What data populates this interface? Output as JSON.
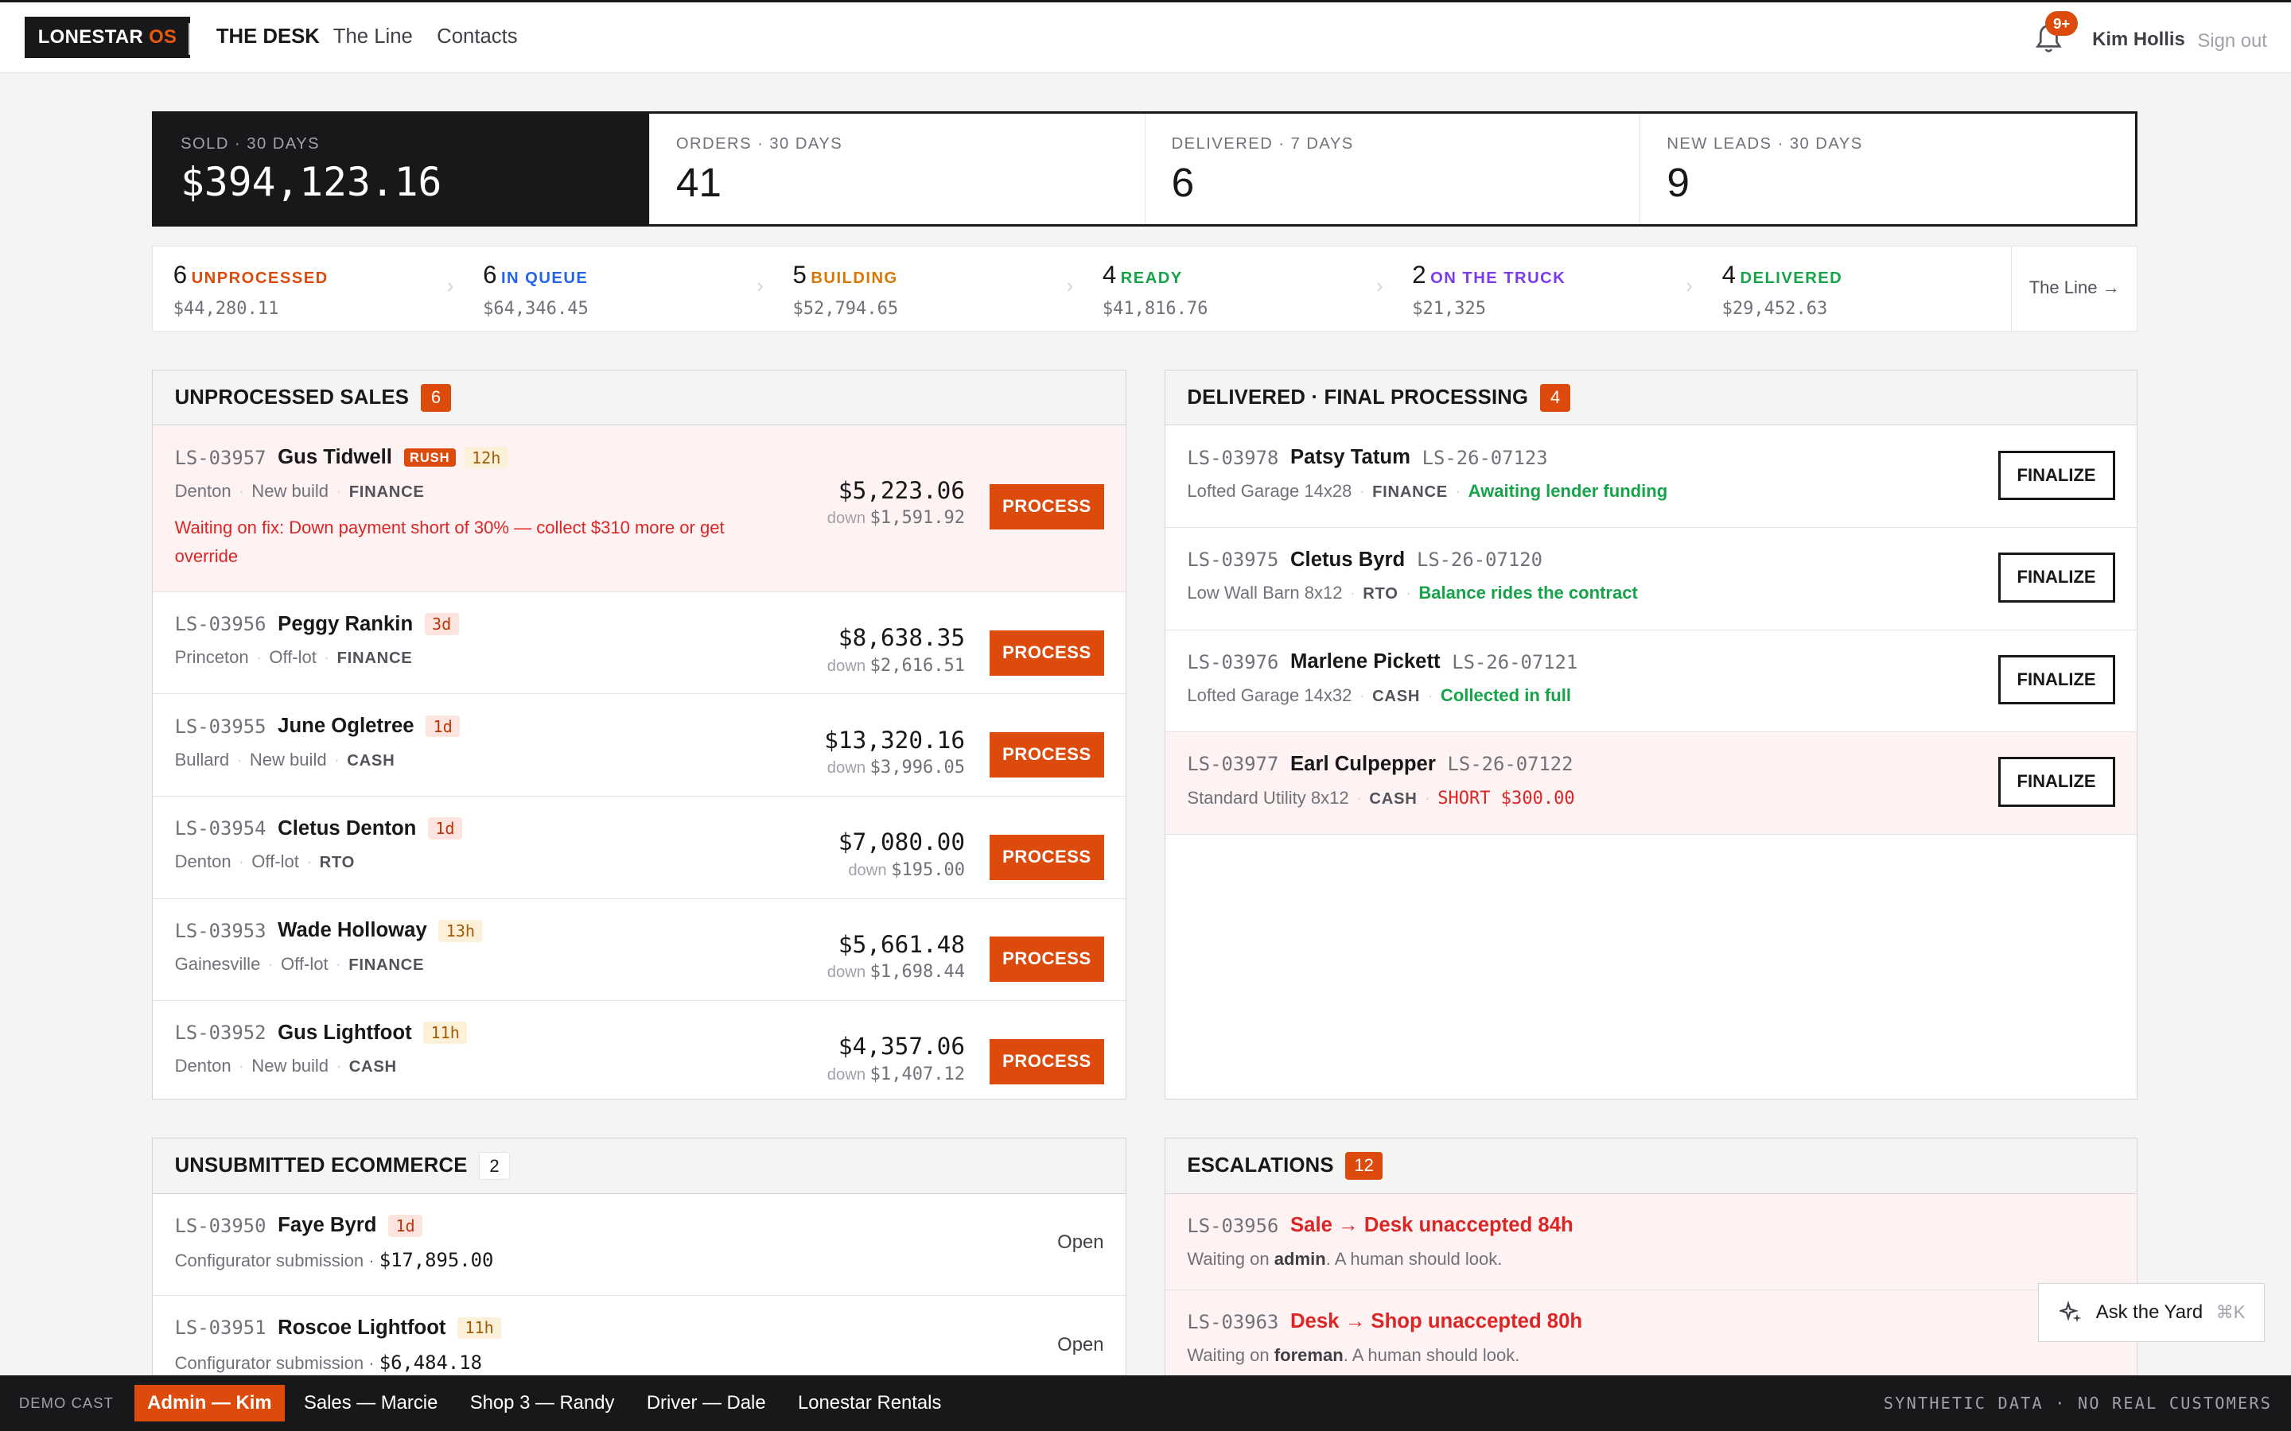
{
  "app": {
    "logo_main": "LONESTAR ",
    "logo_accent": "OS"
  },
  "nav": {
    "desk": "THE DESK",
    "line": "The Line",
    "contacts": "Contacts"
  },
  "user": {
    "notifications": "9+",
    "name": "Kim Hollis",
    "signout": "Sign out"
  },
  "stats": [
    {
      "label": "SOLD · 30 DAYS",
      "value": "$394,123.16"
    },
    {
      "label": "ORDERS · 30 DAYS",
      "value": "41"
    },
    {
      "label": "DELIVERED · 7 DAYS",
      "value": "6"
    },
    {
      "label": "NEW LEADS · 30 DAYS",
      "value": "9"
    }
  ],
  "pipeline": {
    "stages": [
      {
        "count": "6",
        "name": "UNPROCESSED",
        "amount": "$44,280.11",
        "color": "#dc4a0c"
      },
      {
        "count": "6",
        "name": "IN QUEUE",
        "amount": "$64,346.45",
        "color": "#2563eb"
      },
      {
        "count": "5",
        "name": "BUILDING",
        "amount": "$52,794.65",
        "color": "#d97706"
      },
      {
        "count": "4",
        "name": "READY",
        "amount": "$41,816.76",
        "color": "#16a34a"
      },
      {
        "count": "2",
        "name": "ON THE TRUCK",
        "amount": "$21,325",
        "color": "#7c3aed"
      },
      {
        "count": "4",
        "name": "DELIVERED",
        "amount": "$29,452.63",
        "color": "#16a34a"
      }
    ],
    "link": "The Line →"
  },
  "unprocessed": {
    "title": "UNPROCESSED SALES",
    "count": "6",
    "process_label": "PROCESS",
    "rows": [
      {
        "id": "LS-03957",
        "name": "Gus Tidwell",
        "rush": "RUSH",
        "age": "12h",
        "location": "Denton",
        "type": "New build",
        "payment": "FINANCE",
        "price": "$5,223.06",
        "down_label": "down",
        "down": "$1,591.92",
        "warning": "Waiting on fix: Down payment short of 30% — collect $310 more or get override"
      },
      {
        "id": "LS-03956",
        "name": "Peggy Rankin",
        "age": "3d",
        "location": "Princeton",
        "type": "Off-lot",
        "payment": "FINANCE",
        "price": "$8,638.35",
        "down_label": "down",
        "down": "$2,616.51"
      },
      {
        "id": "LS-03955",
        "name": "June Ogletree",
        "age": "1d",
        "location": "Bullard",
        "type": "New build",
        "payment": "CASH",
        "price": "$13,320.16",
        "down_label": "down",
        "down": "$3,996.05"
      },
      {
        "id": "LS-03954",
        "name": "Cletus Denton",
        "age": "1d",
        "location": "Denton",
        "type": "Off-lot",
        "payment": "RTO",
        "price": "$7,080.00",
        "down_label": "down",
        "down": "$195.00"
      },
      {
        "id": "LS-03953",
        "name": "Wade Holloway",
        "age": "13h",
        "location": "Gainesville",
        "type": "Off-lot",
        "payment": "FINANCE",
        "price": "$5,661.48",
        "down_label": "down",
        "down": "$1,698.44"
      },
      {
        "id": "LS-03952",
        "name": "Gus Lightfoot",
        "age": "11h",
        "location": "Denton",
        "type": "New build",
        "payment": "CASH",
        "price": "$4,357.06",
        "down_label": "down",
        "down": "$1,407.12"
      }
    ]
  },
  "delivered": {
    "title": "DELIVERED · FINAL PROCESSING",
    "count": "4",
    "finalize_label": "FINALIZE",
    "rows": [
      {
        "id": "LS-03978",
        "name": "Patsy Tatum",
        "ref": "LS-26-07123",
        "building": "Lofted Garage 14x28",
        "payment": "FINANCE",
        "status": "Awaiting lender funding"
      },
      {
        "id": "LS-03975",
        "name": "Cletus Byrd",
        "ref": "LS-26-07120",
        "building": "Low Wall Barn 8x12",
        "payment": "RTO",
        "status": "Balance rides the contract"
      },
      {
        "id": "LS-03976",
        "name": "Marlene Pickett",
        "ref": "LS-26-07121",
        "building": "Lofted Garage 14x32",
        "payment": "CASH",
        "status": "Collected in full"
      },
      {
        "id": "LS-03977",
        "name": "Earl Culpepper",
        "ref": "LS-26-07122",
        "building": "Standard Utility 8x12",
        "payment": "CASH",
        "status": "SHORT $300.00"
      }
    ]
  },
  "ecommerce": {
    "title": "UNSUBMITTED ECOMMERCE",
    "count": "2",
    "open_label": "Open",
    "rows": [
      {
        "id": "LS-03950",
        "name": "Faye Byrd",
        "age": "1d",
        "source": "Configurator submission ·",
        "amount": "$17,895.00"
      },
      {
        "id": "LS-03951",
        "name": "Roscoe Lightfoot",
        "age": "11h",
        "source": "Configurator submission ·",
        "amount": "$6,484.18"
      }
    ]
  },
  "escalations": {
    "title": "ESCALATIONS",
    "count": "12",
    "rows": [
      {
        "id": "LS-03956",
        "title": "Sale → Desk unaccepted 84h",
        "pre": "Waiting on ",
        "who": "admin",
        "post": ". A human should look."
      },
      {
        "id": "LS-03963",
        "title": "Desk → Shop unaccepted 80h",
        "pre": "Waiting on ",
        "who": "foreman",
        "post": ". A human should look."
      }
    ]
  },
  "ask": {
    "label": "Ask the Yard",
    "shortcut": "⌘K"
  },
  "footer": {
    "demo": "DEMO CAST",
    "cast": [
      "Admin — Kim",
      "Sales — Marcie",
      "Shop 3 — Randy",
      "Driver — Dale",
      "Lonestar Rentals"
    ],
    "notice": "SYNTHETIC DATA · NO REAL CUSTOMERS"
  }
}
